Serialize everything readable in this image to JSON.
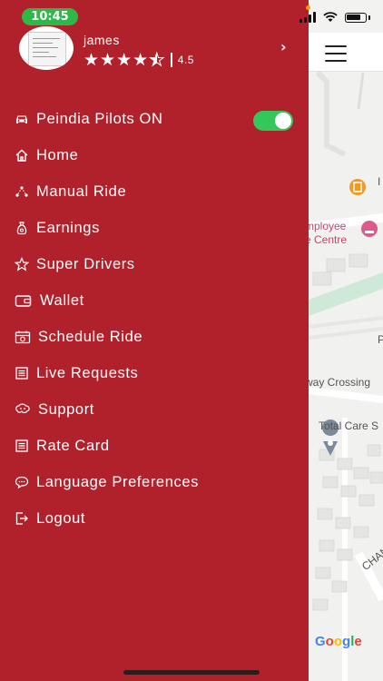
{
  "status_bar": {
    "time": "10:45"
  },
  "profile": {
    "name": "james",
    "rating": "4.5",
    "rating_stars": 4.5
  },
  "drawer": {
    "items": [
      {
        "label": "Peindia Pilots ON",
        "icon": "car-icon"
      },
      {
        "label": "Home",
        "icon": "home-icon"
      },
      {
        "label": "Manual Ride",
        "icon": "route-icon"
      },
      {
        "label": "Earnings",
        "icon": "money-bag-icon"
      },
      {
        "label": "Super Drivers",
        "icon": "star-outline-icon"
      },
      {
        "label": "Wallet",
        "icon": "wallet-icon"
      },
      {
        "label": "Schedule Ride",
        "icon": "calendar-icon"
      },
      {
        "label": "Live Requests",
        "icon": "list-icon"
      },
      {
        "label": "Support",
        "icon": "support-icon"
      },
      {
        "label": "Rate Card",
        "icon": "document-icon"
      },
      {
        "label": "Language Preferences",
        "icon": "chat-bubble-icon"
      },
      {
        "label": "Logout",
        "icon": "logout-icon"
      }
    ],
    "online_toggle": true
  },
  "map": {
    "labels": {
      "employee": "mployee",
      "centre": "e Centre",
      "crossing": "way Crossing",
      "total_care": "Total Care S",
      "p_label": "P",
      "cha": "CHAN",
      "l_label": "I"
    },
    "google": "Google"
  },
  "colors": {
    "drawer_bg": "#b0212b",
    "toggle_on": "#34c759",
    "status_pill": "#2fb84a"
  }
}
